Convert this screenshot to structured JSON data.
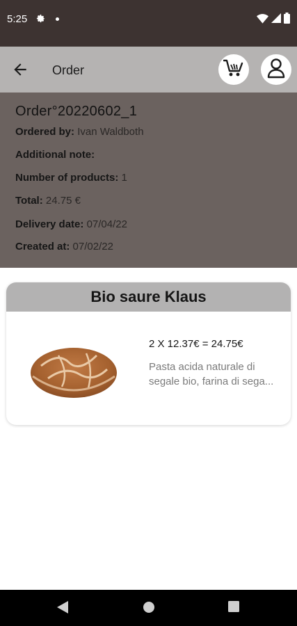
{
  "status_bar": {
    "time": "5:25",
    "icons": [
      "gear-icon",
      "dot-icon",
      "wifi-icon",
      "signal-icon",
      "battery-icon"
    ]
  },
  "app_bar": {
    "title": "Order",
    "icons": [
      "back-arrow-icon",
      "cart-icon",
      "user-icon"
    ]
  },
  "order": {
    "id": "Order°20220602_1",
    "ordered_by_label": "Ordered by:",
    "ordered_by_value": "Ivan Waldboth",
    "note_label": "Additional note:",
    "products_label": "Number of products:",
    "products_value": "1",
    "total_label": "Total:",
    "total_value": "24.75 €",
    "delivery_label": "Delivery date:",
    "delivery_value": "07/04/22",
    "created_label": "Created at:",
    "created_value": "07/02/22"
  },
  "product": {
    "name": "Bio saure Klaus",
    "price_line": "2 X 12.37€ = 24.75€",
    "description": "Pasta acida naturale di segale bio, farina di sega..."
  },
  "colors": {
    "status_bar": "#3d3331",
    "app_bar": "#b5b3b2",
    "order_panel": "#6b625f",
    "card_header": "#b3b2b2"
  },
  "nav_bar": {
    "icons": [
      "back-triangle-icon",
      "home-circle-icon",
      "recents-square-icon"
    ]
  }
}
